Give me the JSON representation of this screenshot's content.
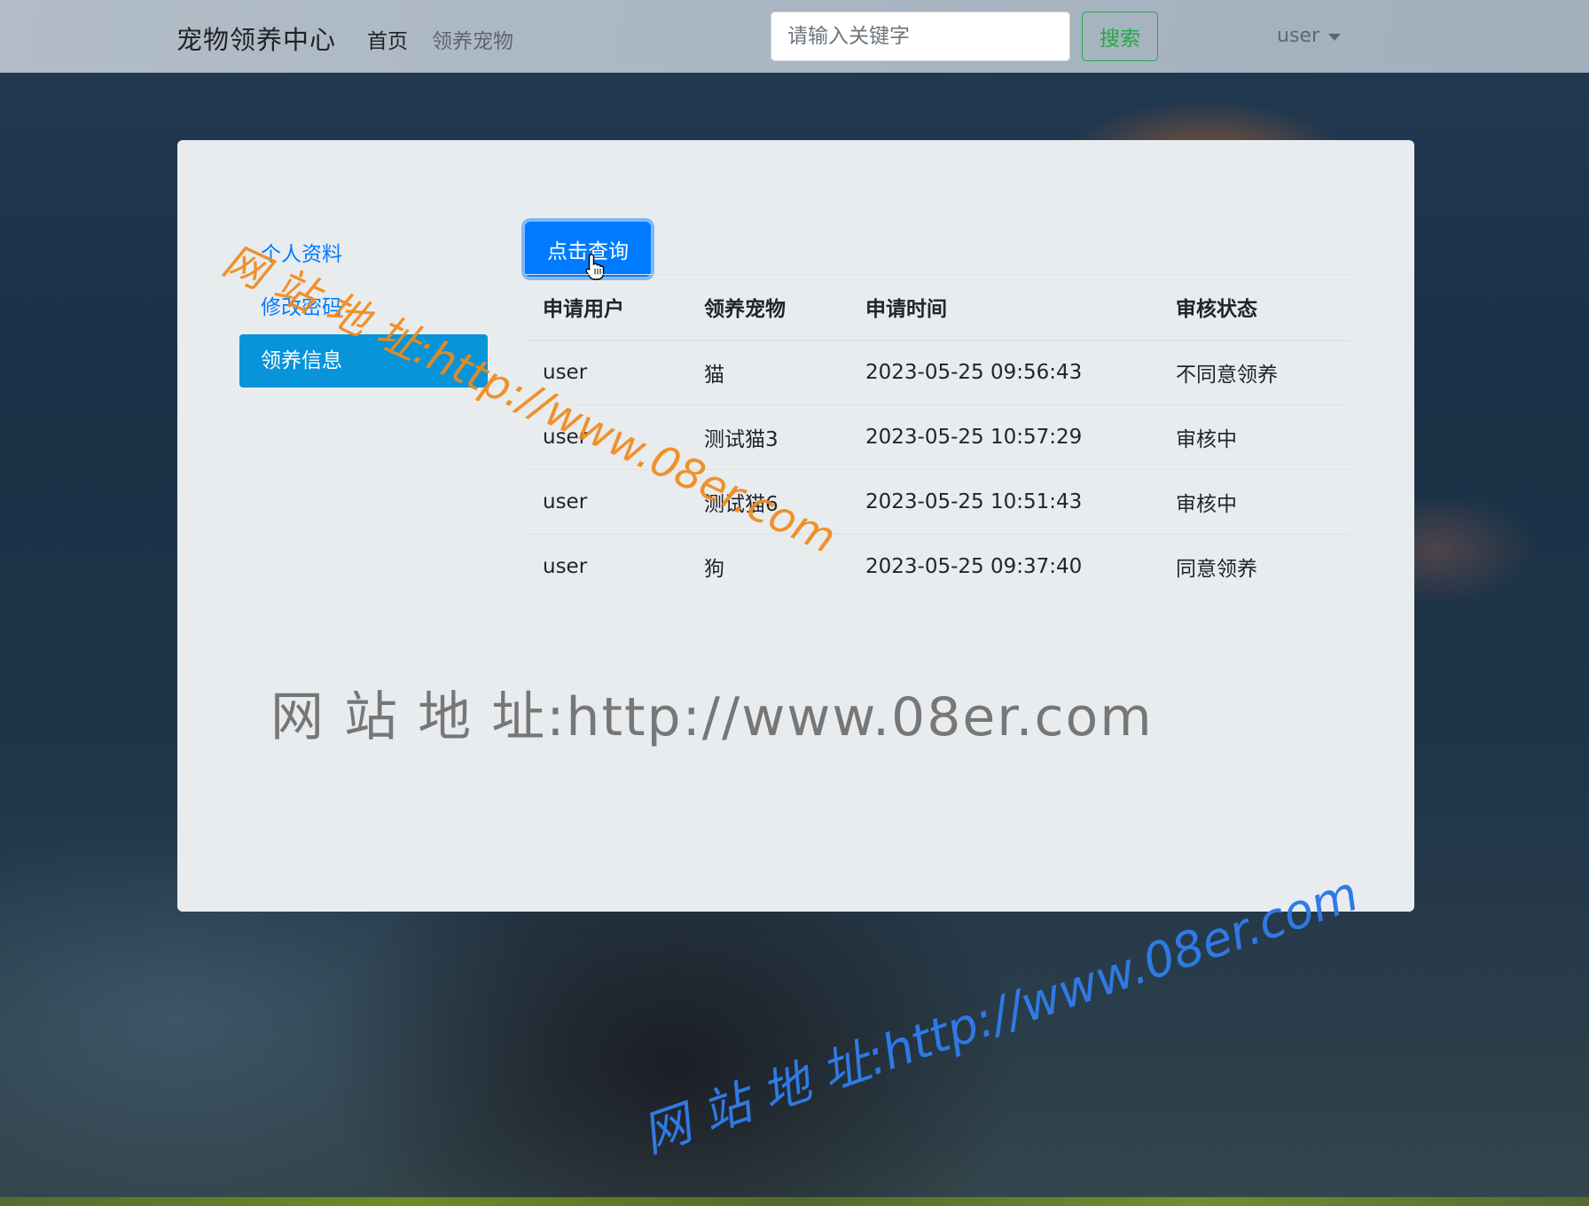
{
  "navbar": {
    "brand": "宠物领养中心",
    "links": [
      {
        "label": "首页"
      },
      {
        "label": "领养宠物"
      }
    ],
    "search": {
      "placeholder": "请输入关键字",
      "button_label": "搜索"
    },
    "user": {
      "label": "user"
    }
  },
  "sidebar": {
    "items": [
      {
        "label": "个人资料"
      },
      {
        "label": "修改密码"
      },
      {
        "label": "领养信息",
        "active": true
      }
    ]
  },
  "main": {
    "query_button": "点击查询",
    "table": {
      "columns": [
        "申请用户",
        "领养宠物",
        "申请时间",
        "审核状态"
      ],
      "rows": [
        [
          "user",
          "猫",
          "2023-05-25 09:56:43",
          "不同意领养"
        ],
        [
          "user",
          "测试猫3",
          "2023-05-25 10:57:29",
          "审核中"
        ],
        [
          "user",
          "测试猫6",
          "2023-05-25 10:51:43",
          "审核中"
        ],
        [
          "user",
          "狗",
          "2023-05-25 09:37:40",
          "同意领养"
        ]
      ]
    }
  },
  "watermarks": {
    "orange": "网 站 地 址:http://www.08er.com",
    "gray": "网 站 地 址:http://www.08er.com",
    "blue": "网 站 地 址:http://www.08er.com"
  },
  "colors": {
    "primary": "#007bff",
    "active_item": "#0794d9",
    "search_button": "#28a745",
    "card_background": "#e9ecef"
  }
}
